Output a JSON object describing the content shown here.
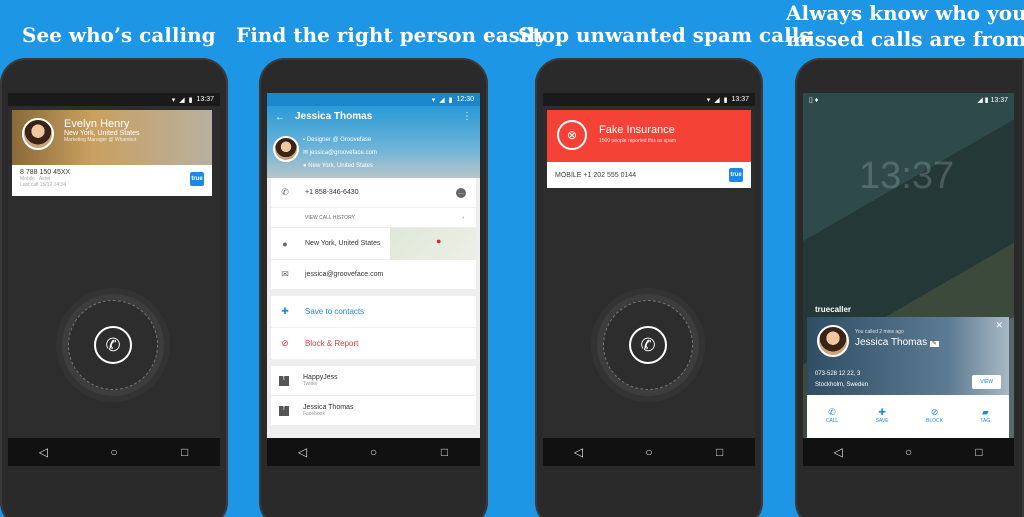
{
  "headlines": {
    "h1": "See who’s calling",
    "h2": "Find the right person easily",
    "h3": "Stop unwanted spam calls",
    "h4_line1": "Always know who your",
    "h4_line2": "missed calls are from"
  },
  "status": {
    "time": "13:37",
    "time2": "12:30"
  },
  "phone1": {
    "name": "Evelyn Henry",
    "location": "New York, United States",
    "job": "Marketing Manager @ Whambot",
    "number": "8 788 150 45XX",
    "carrier": "Mobile - Airtel",
    "last_call": "Last call 15/12 14:34",
    "badge": "true"
  },
  "phone2": {
    "name": "Jessica Thomas",
    "job": "Designer @ Groovefase",
    "email_header": "jessica@grooveface.com",
    "location_header": "New York, United States",
    "phone": "+1 858-346-6430",
    "history": "VIEW CALL HISTORY",
    "location": "New York, United States",
    "email": "jessica@grooveface.com",
    "save": "Save to contacts",
    "block": "Block & Report",
    "social": [
      {
        "name": "HappyJess",
        "source": "Twitter"
      },
      {
        "name": "Jessica Thomas",
        "source": "Facebook"
      }
    ]
  },
  "phone3": {
    "title": "Fake Insurance",
    "subtitle": "1500 people reported this as spam",
    "number": "MOBILE +1 202 555 0144",
    "badge": "true"
  },
  "phone4": {
    "clock": "13:37",
    "brand": "truecaller",
    "called": "You called 2 mins ago",
    "name": "Jessica Thomas",
    "number": "073-528 12 22, 3",
    "location": "Stockholm, Sweden",
    "view": "VIEW",
    "actions": [
      "CALL",
      "SAVE",
      "BLOCK",
      "TAG"
    ]
  },
  "colors": {
    "background": "#1e96e6",
    "spam_red": "#f44336",
    "accent_blue": "#1e88e5"
  }
}
